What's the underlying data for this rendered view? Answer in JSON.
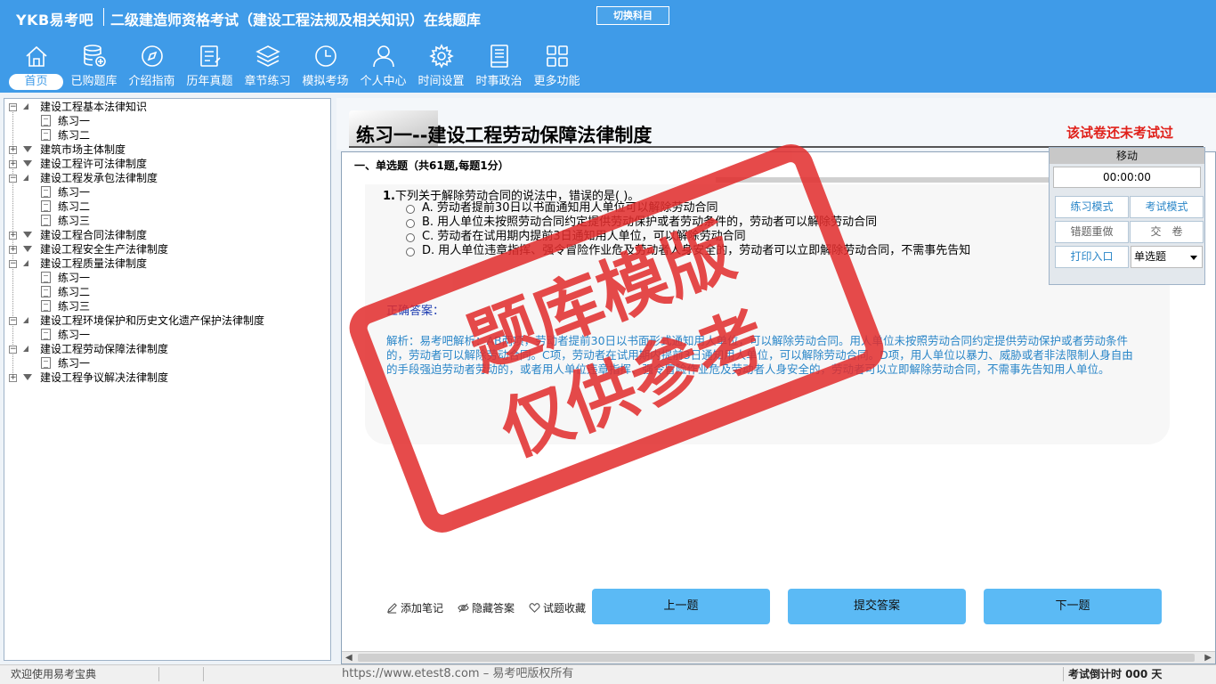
{
  "header": {
    "brand": "YKB易考吧",
    "title": "二级建造师资格考试（建设工程法规及相关知识）在线题库",
    "switch_label": "切换科目",
    "nav": [
      {
        "label": "首页",
        "icon": "home-icon"
      },
      {
        "label": "已购题库",
        "icon": "database-icon"
      },
      {
        "label": "介绍指南",
        "icon": "compass-icon"
      },
      {
        "label": "历年真题",
        "icon": "list-icon"
      },
      {
        "label": "章节练习",
        "icon": "layers-icon"
      },
      {
        "label": "模拟考场",
        "icon": "clock-icon"
      },
      {
        "label": "个人中心",
        "icon": "user-icon"
      },
      {
        "label": "时间设置",
        "icon": "gear-icon"
      },
      {
        "label": "时事政治",
        "icon": "book-icon"
      },
      {
        "label": "更多功能",
        "icon": "grid-icon"
      }
    ]
  },
  "tree": {
    "items": [
      {
        "label": "建设工程基本法律知识",
        "level": 0
      },
      {
        "label": "练习一",
        "level": 1
      },
      {
        "label": "练习二",
        "level": 1
      },
      {
        "label": "建筑市场主体制度",
        "level": 0
      },
      {
        "label": "建设工程许可法律制度",
        "level": 0
      },
      {
        "label": "建设工程发承包法律制度",
        "level": 0
      },
      {
        "label": "练习一",
        "level": 1
      },
      {
        "label": "练习二",
        "level": 1
      },
      {
        "label": "练习三",
        "level": 1
      },
      {
        "label": "建设工程合同法律制度",
        "level": 0
      },
      {
        "label": "建设工程安全生产法律制度",
        "level": 0
      },
      {
        "label": "建设工程质量法律制度",
        "level": 0
      },
      {
        "label": "练习一",
        "level": 1
      },
      {
        "label": "练习二",
        "level": 1
      },
      {
        "label": "练习三",
        "level": 1
      },
      {
        "label": "建设工程环境保护和历史文化遗产保护法律制度",
        "level": 0
      },
      {
        "label": "练习一",
        "level": 1
      },
      {
        "label": "建设工程劳动保障法律制度",
        "level": 0
      },
      {
        "label": "练习一",
        "level": 1
      },
      {
        "label": "建设工程争议解决法律制度",
        "level": 0
      }
    ]
  },
  "main": {
    "paper_title": "练习一--建设工程劳动保障法律制度",
    "status_text": "该试卷还未考试过",
    "section_title": "一、单选题（共61题,每题1分）",
    "question": {
      "number": "1.",
      "text": "下列关于解除劳动合同的说法中，错误的是(  )。",
      "options": [
        "A. 劳动者提前30日以书面通知用人单位可以解除劳动合同",
        "B. 用人单位未按照劳动合同约定提供劳动保护或者劳动条件的，劳动者可以解除劳动合同",
        "C. 劳动者在试用期内提前3日通知用人单位，可以解除劳动合同",
        "D. 用人单位违章指挥、强令冒险作业危及劳动者人身安全的，劳动者可以立即解除劳动合同，不需事先告知"
      ],
      "answer_label": "正确答案：",
      "analysis": "解析：易考吧解析：AB两项，劳动者提前30日以书面形式通知用人单位，可以解除劳动合同。用人单位未按照劳动合同约定提供劳动保护或者劳动条件的，劳动者可以解除劳动合同。C项，劳动者在试用期内提前3日通知用人单位，可以解除劳动合同。D项，用人单位以暴力、威胁或者非法限制人身自由的手段强迫劳动者劳动的，或者用人单位违章指挥、强令冒险作业危及劳动者人身安全的，劳动者可以立即解除劳动合同，不需事先告知用人单位。"
    },
    "tools": {
      "add_note": "添加笔记",
      "hide_answer": "隐藏答案",
      "favorite": "试题收藏"
    },
    "buttons": {
      "prev": "上一题",
      "submit_answer": "提交答案",
      "next": "下一题"
    }
  },
  "timer": {
    "head": "移动",
    "time": "00:00:00",
    "practice_mode": "练习模式",
    "exam_mode": "考试模式",
    "redo_wrong": "错题重做",
    "hand_in": "交　卷",
    "print": "打印入口",
    "type_select": "单选题"
  },
  "statusbar": {
    "welcome": "欢迎使用易考宝典",
    "url": "https://www.etest8.com – 易考吧版权所有",
    "countdown": "考试倒计时 000 天"
  },
  "watermark": {
    "line1": "题库模版",
    "line2": "仅供参考"
  }
}
